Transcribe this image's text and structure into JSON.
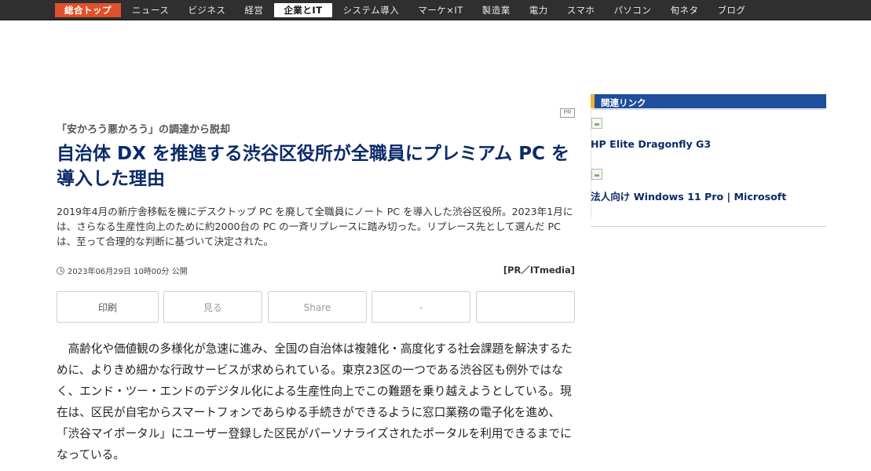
{
  "nav": {
    "home": "総合トップ",
    "items": [
      "ニュース",
      "ビジネス",
      "経営",
      "企業とIT",
      "システム導入",
      "マーケ×IT",
      "製造業",
      "電力",
      "スマホ",
      "パソコン",
      "旬ネタ",
      "ブログ"
    ],
    "active_index": 3
  },
  "article": {
    "pr_badge": "PR",
    "kicker": "「安かろう悪かろう」の調達から脱却",
    "title": "自治体 DX を推進する渋谷区役所が全職員にプレミアム PC を導入した理由",
    "lead": "2019年4月の新庁舎移転を機にデスクトップ PC を廃して全職員にノート PC を導入した渋谷区役所。2023年1月には、さらなる生産性向上のために約2000台の PC の一斉リプレースに踏み切った。リプレース先として選んだ PC は、至って合理的な判断に基づいて決定された。",
    "date": "2023年06月29日 10時00分 公開",
    "byline": "[PR／ITmedia]",
    "share_buttons": [
      "印刷",
      "見る",
      "Share",
      "-",
      ""
    ],
    "body": "高齢化や価値観の多様化が急速に進み、全国の自治体は複雑化・高度化する社会課題を解決するために、よりきめ細かな行政サービスが求められている。東京23区の一つである渋谷区も例外ではなく、エンド・ツー・エンドのデジタル化による生産性向上でこの難題を乗り越えようとしている。現在は、区民が自宅からスマートフォンであらゆる手続きができるように窓口業務の電子化を進め、「渋谷マイポータル」にユーザー登録した区民がパーソナライズされたポータルを利用できるまでになっている。"
  },
  "sidebar": {
    "heading": "関連リンク",
    "links": [
      {
        "label": "HP Elite Dragonfly G3"
      },
      {
        "label": "法人向け Windows 11 Pro | Microsoft"
      }
    ]
  },
  "colors": {
    "nav_bg": "#2f2f2f",
    "home_bg": "#e2502b",
    "title": "#0b2a6a",
    "sidebar_header": "#1e4e9c",
    "sidebar_accent": "#f2b233"
  }
}
